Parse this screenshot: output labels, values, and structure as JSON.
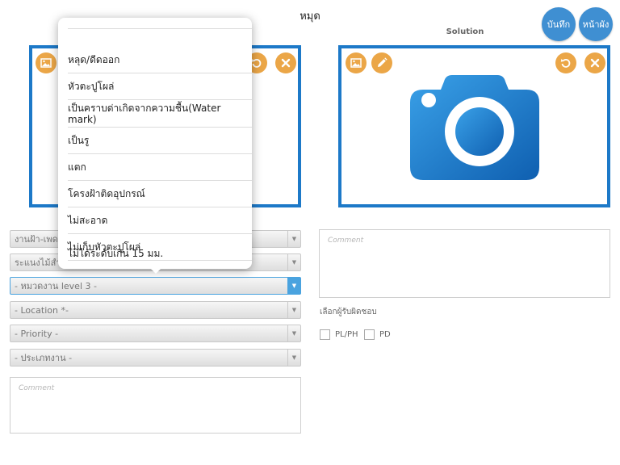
{
  "header": {
    "title": "หมุด",
    "save_label": "บันทึก",
    "home_label": "หน้าผัง"
  },
  "solution": {
    "label": "Solution"
  },
  "colors": {
    "frame_border": "#1d79c8",
    "action_button": "#eba647",
    "header_button": "#3f8fd2",
    "select_active": "#4aa3df"
  },
  "problem_photo": {
    "icons": [
      "image-icon",
      "undo-icon",
      "close-icon"
    ]
  },
  "solution_photo": {
    "icons": [
      "image-icon",
      "pencil-icon",
      "undo-icon",
      "close-icon",
      "camera-icon"
    ]
  },
  "form": {
    "selects": [
      {
        "value": "งานฝ้า-เพดาน"
      },
      {
        "value": "ระแนงไม้สำเร็จ"
      },
      {
        "value": "- หมวดงาน level 3 -"
      },
      {
        "value": "- Location *-"
      },
      {
        "value": "- Priority -"
      },
      {
        "value": "- ประเภทงาน -"
      }
    ],
    "comment_placeholder": "Comment"
  },
  "solution_form": {
    "comment_placeholder": "Comment",
    "responsible_label": "เลือกผู้รับผิดชอบ",
    "checkboxes": [
      {
        "label": "PL/PH"
      },
      {
        "label": "PD"
      }
    ]
  },
  "dropdown": {
    "items": [
      {
        "label": "หลุด/ดีดออก"
      },
      {
        "label": "หัวตะปูโผล่"
      },
      {
        "label": "เป็นคราบด่าเกิดจากความชื้น(Water mark)"
      },
      {
        "label": "เป็นรู"
      },
      {
        "label": "แตก"
      },
      {
        "label": "โครงฝ้าติดอุปกรณ์"
      },
      {
        "label": "ไม่สะอาด"
      },
      {
        "label": "ไม่เก็บหัวตะปูโผล่"
      },
      {
        "label": "ไม่ได้ระดับเกิน 15 มม."
      }
    ]
  }
}
